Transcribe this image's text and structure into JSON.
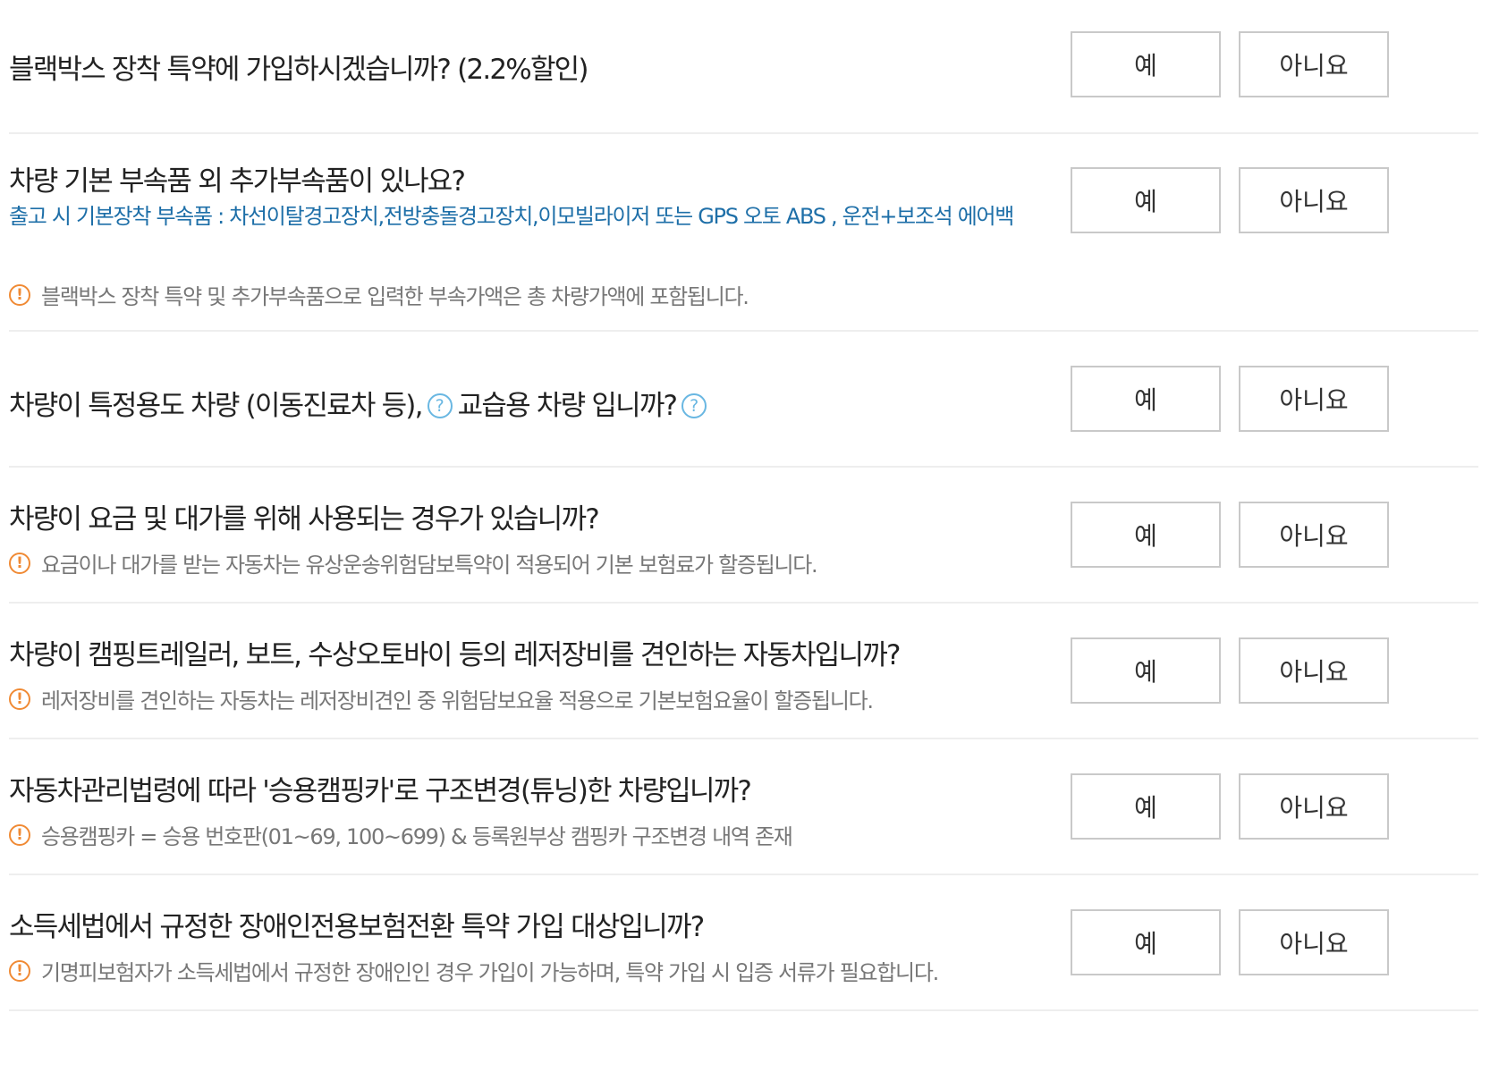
{
  "questions": [
    {
      "title": "블랙박스 장착 특약에 가입하시겠습니까? (2.2%할인)",
      "yes_label": "예",
      "no_label": "아니요"
    },
    {
      "title": "차량 기본 부속품 외 추가부속품이 있나요?",
      "info": "출고 시 기본장착 부속품 : 차선이탈경고장치,전방충돌경고장치,이모빌라이저 또는 GPS 오토 ABS , 운전+보조석 에어백",
      "note": "블랙박스 장착 특약 및 추가부속품으로 입력한 부속가액은 총 차량가액에 포함됩니다.",
      "yes_label": "예",
      "no_label": "아니요"
    },
    {
      "title_part1": "차량이 특정용도 차량 (이동진료차 등),",
      "title_part2": "교습용 차량 입니까?",
      "yes_label": "예",
      "no_label": "아니요"
    },
    {
      "title": "차량이 요금 및 대가를 위해 사용되는 경우가 있습니까?",
      "note": "요금이나 대가를 받는 자동차는 유상운송위험담보특약이 적용되어 기본 보험료가 할증됩니다.",
      "yes_label": "예",
      "no_label": "아니요"
    },
    {
      "title": "차량이 캠핑트레일러, 보트, 수상오토바이 등의 레저장비를 견인하는 자동차입니까?",
      "note": "레저장비를 견인하는 자동차는 레저장비견인 중 위험담보요율 적용으로 기본보험요율이 할증됩니다.",
      "yes_label": "예",
      "no_label": "아니요"
    },
    {
      "title": "자동차관리법령에 따라 '승용캠핑카'로 구조변경(튜닝)한 차량입니까?",
      "note": "승용캠핑카 = 승용 번호판(01~69, 100~699) & 등록원부상 캠핑카 구조변경 내역 존재",
      "yes_label": "예",
      "no_label": "아니요"
    },
    {
      "title": "소득세법에서 규정한 장애인전용보험전환 특약 가입 대상입니까?",
      "note": "기명피보험자가 소득세법에서 규정한 장애인인 경우 가입이 가능하며, 특약 가입 시 입증 서류가 필요합니다.",
      "yes_label": "예",
      "no_label": "아니요"
    }
  ],
  "icons": {
    "warning_glyph": "!",
    "help_glyph": "?",
    "warning_color": "#f08a34",
    "help_color": "#69b7e2",
    "info_text_color": "#1e6fa8"
  }
}
